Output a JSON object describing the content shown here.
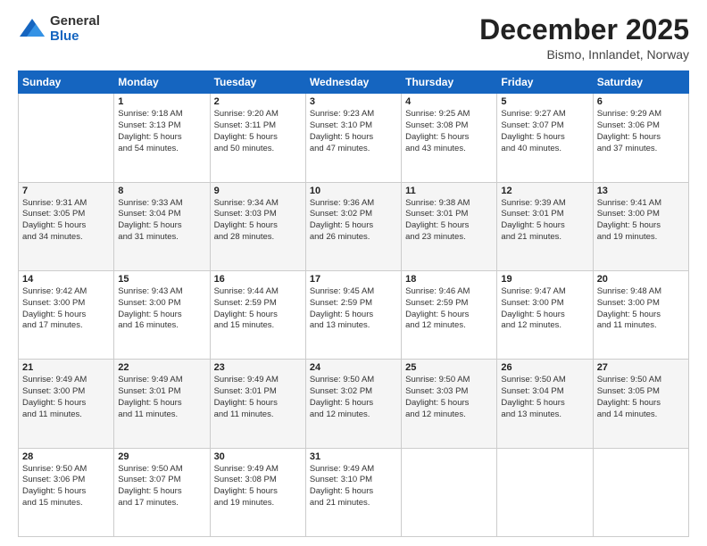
{
  "logo": {
    "general": "General",
    "blue": "Blue"
  },
  "header": {
    "month": "December 2025",
    "location": "Bismo, Innlandet, Norway"
  },
  "weekdays": [
    "Sunday",
    "Monday",
    "Tuesday",
    "Wednesday",
    "Thursday",
    "Friday",
    "Saturday"
  ],
  "weeks": [
    [
      {
        "day": "",
        "detail": ""
      },
      {
        "day": "1",
        "detail": "Sunrise: 9:18 AM\nSunset: 3:13 PM\nDaylight: 5 hours\nand 54 minutes."
      },
      {
        "day": "2",
        "detail": "Sunrise: 9:20 AM\nSunset: 3:11 PM\nDaylight: 5 hours\nand 50 minutes."
      },
      {
        "day": "3",
        "detail": "Sunrise: 9:23 AM\nSunset: 3:10 PM\nDaylight: 5 hours\nand 47 minutes."
      },
      {
        "day": "4",
        "detail": "Sunrise: 9:25 AM\nSunset: 3:08 PM\nDaylight: 5 hours\nand 43 minutes."
      },
      {
        "day": "5",
        "detail": "Sunrise: 9:27 AM\nSunset: 3:07 PM\nDaylight: 5 hours\nand 40 minutes."
      },
      {
        "day": "6",
        "detail": "Sunrise: 9:29 AM\nSunset: 3:06 PM\nDaylight: 5 hours\nand 37 minutes."
      }
    ],
    [
      {
        "day": "7",
        "detail": "Sunrise: 9:31 AM\nSunset: 3:05 PM\nDaylight: 5 hours\nand 34 minutes."
      },
      {
        "day": "8",
        "detail": "Sunrise: 9:33 AM\nSunset: 3:04 PM\nDaylight: 5 hours\nand 31 minutes."
      },
      {
        "day": "9",
        "detail": "Sunrise: 9:34 AM\nSunset: 3:03 PM\nDaylight: 5 hours\nand 28 minutes."
      },
      {
        "day": "10",
        "detail": "Sunrise: 9:36 AM\nSunset: 3:02 PM\nDaylight: 5 hours\nand 26 minutes."
      },
      {
        "day": "11",
        "detail": "Sunrise: 9:38 AM\nSunset: 3:01 PM\nDaylight: 5 hours\nand 23 minutes."
      },
      {
        "day": "12",
        "detail": "Sunrise: 9:39 AM\nSunset: 3:01 PM\nDaylight: 5 hours\nand 21 minutes."
      },
      {
        "day": "13",
        "detail": "Sunrise: 9:41 AM\nSunset: 3:00 PM\nDaylight: 5 hours\nand 19 minutes."
      }
    ],
    [
      {
        "day": "14",
        "detail": "Sunrise: 9:42 AM\nSunset: 3:00 PM\nDaylight: 5 hours\nand 17 minutes."
      },
      {
        "day": "15",
        "detail": "Sunrise: 9:43 AM\nSunset: 3:00 PM\nDaylight: 5 hours\nand 16 minutes."
      },
      {
        "day": "16",
        "detail": "Sunrise: 9:44 AM\nSunset: 2:59 PM\nDaylight: 5 hours\nand 15 minutes."
      },
      {
        "day": "17",
        "detail": "Sunrise: 9:45 AM\nSunset: 2:59 PM\nDaylight: 5 hours\nand 13 minutes."
      },
      {
        "day": "18",
        "detail": "Sunrise: 9:46 AM\nSunset: 2:59 PM\nDaylight: 5 hours\nand 12 minutes."
      },
      {
        "day": "19",
        "detail": "Sunrise: 9:47 AM\nSunset: 3:00 PM\nDaylight: 5 hours\nand 12 minutes."
      },
      {
        "day": "20",
        "detail": "Sunrise: 9:48 AM\nSunset: 3:00 PM\nDaylight: 5 hours\nand 11 minutes."
      }
    ],
    [
      {
        "day": "21",
        "detail": "Sunrise: 9:49 AM\nSunset: 3:00 PM\nDaylight: 5 hours\nand 11 minutes."
      },
      {
        "day": "22",
        "detail": "Sunrise: 9:49 AM\nSunset: 3:01 PM\nDaylight: 5 hours\nand 11 minutes."
      },
      {
        "day": "23",
        "detail": "Sunrise: 9:49 AM\nSunset: 3:01 PM\nDaylight: 5 hours\nand 11 minutes."
      },
      {
        "day": "24",
        "detail": "Sunrise: 9:50 AM\nSunset: 3:02 PM\nDaylight: 5 hours\nand 12 minutes."
      },
      {
        "day": "25",
        "detail": "Sunrise: 9:50 AM\nSunset: 3:03 PM\nDaylight: 5 hours\nand 12 minutes."
      },
      {
        "day": "26",
        "detail": "Sunrise: 9:50 AM\nSunset: 3:04 PM\nDaylight: 5 hours\nand 13 minutes."
      },
      {
        "day": "27",
        "detail": "Sunrise: 9:50 AM\nSunset: 3:05 PM\nDaylight: 5 hours\nand 14 minutes."
      }
    ],
    [
      {
        "day": "28",
        "detail": "Sunrise: 9:50 AM\nSunset: 3:06 PM\nDaylight: 5 hours\nand 15 minutes."
      },
      {
        "day": "29",
        "detail": "Sunrise: 9:50 AM\nSunset: 3:07 PM\nDaylight: 5 hours\nand 17 minutes."
      },
      {
        "day": "30",
        "detail": "Sunrise: 9:49 AM\nSunset: 3:08 PM\nDaylight: 5 hours\nand 19 minutes."
      },
      {
        "day": "31",
        "detail": "Sunrise: 9:49 AM\nSunset: 3:10 PM\nDaylight: 5 hours\nand 21 minutes."
      },
      {
        "day": "",
        "detail": ""
      },
      {
        "day": "",
        "detail": ""
      },
      {
        "day": "",
        "detail": ""
      }
    ]
  ]
}
